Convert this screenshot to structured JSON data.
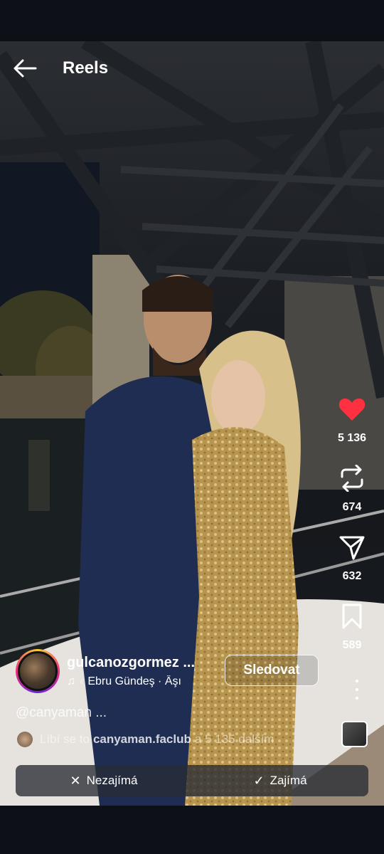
{
  "header": {
    "title": "Reels",
    "back_icon": "arrow-left-icon"
  },
  "actions": {
    "like": {
      "icon": "heart-icon",
      "count": "5 136",
      "color": "#ff3040"
    },
    "repost": {
      "icon": "repost-icon",
      "count": "674"
    },
    "share": {
      "icon": "send-icon",
      "count": "632"
    },
    "save": {
      "icon": "bookmark-icon",
      "count": "589"
    },
    "more": {
      "icon": "more-vertical-icon"
    }
  },
  "author": {
    "username": "gulcanozgormez ...",
    "follow_label": "Sledovat"
  },
  "music": {
    "note": "♫",
    "prefix": "‹",
    "track": "Ebru Gündeş · Âşı"
  },
  "caption": "@canyaman ...",
  "likes": {
    "prefix": "Líbí se to",
    "user": "canyaman.faclub",
    "suffix": "a 5 135 dalším"
  },
  "feedback": {
    "not_interested": {
      "icon": "close-icon",
      "label": "Nezajímá"
    },
    "interested": {
      "icon": "check-icon",
      "label": "Zajímá"
    }
  }
}
